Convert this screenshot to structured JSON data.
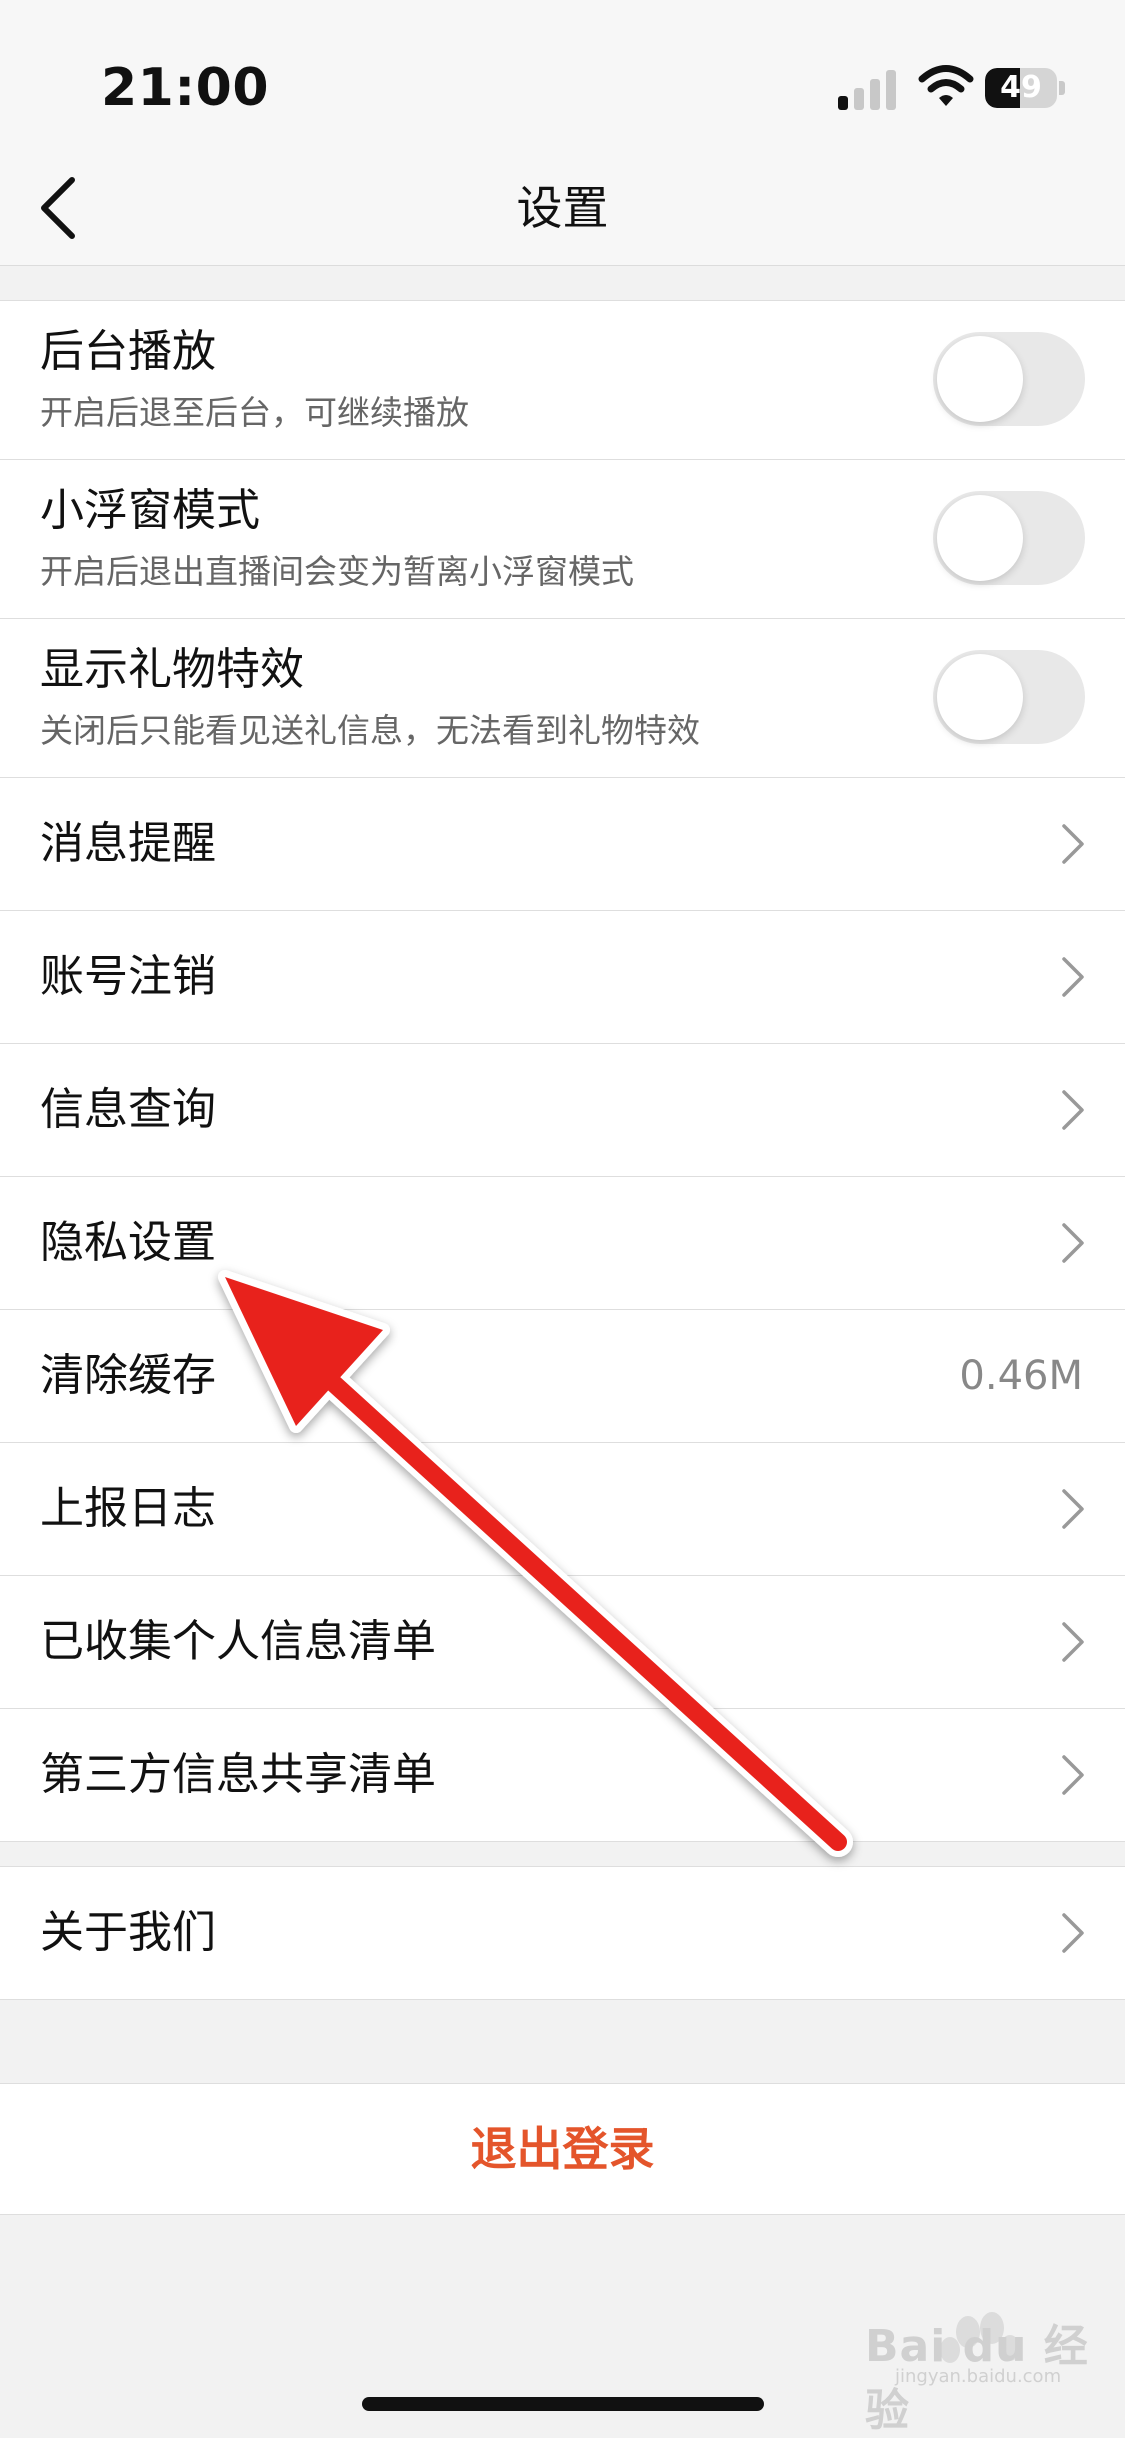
{
  "status": {
    "time": "21:00",
    "battery": "49",
    "battery_level": 0.49
  },
  "nav": {
    "title": "设置",
    "back_icon": "chevron-left-icon"
  },
  "toggles": [
    {
      "label": "后台播放",
      "subtitle": "开启后退至后台，可继续播放",
      "on": false
    },
    {
      "label": "小浮窗模式",
      "subtitle": "开启后退出直播间会变为暂离小浮窗模式",
      "on": false
    },
    {
      "label": "显示礼物特效",
      "subtitle": "关闭后只能看见送礼信息，无法看到礼物特效",
      "on": false
    }
  ],
  "items": [
    {
      "label": "消息提醒"
    },
    {
      "label": "账号注销"
    },
    {
      "label": "信息查询"
    },
    {
      "label": "隐私设置"
    },
    {
      "label": "清除缓存",
      "value": "0.46M"
    },
    {
      "label": "上报日志"
    },
    {
      "label": "已收集个人信息清单"
    },
    {
      "label": "第三方信息共享清单"
    }
  ],
  "about": {
    "label": "关于我们"
  },
  "logout": {
    "label": "退出登录"
  },
  "watermark": {
    "brand": "Bai du 经验",
    "url": "jingyan.baidu.com"
  },
  "colors": {
    "accent": "#e4552b",
    "arrow": "#e8221f"
  }
}
